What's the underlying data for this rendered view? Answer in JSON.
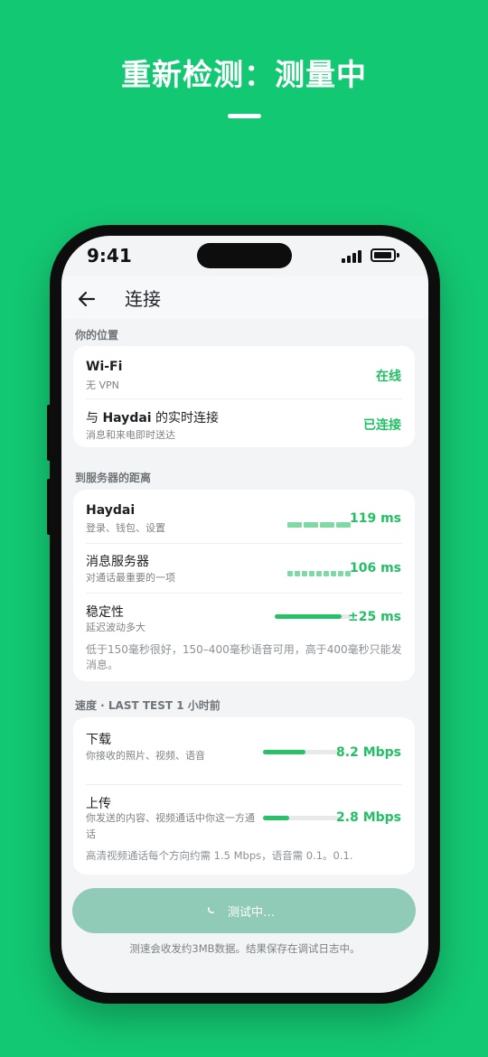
{
  "headline": "重新检测：测量中",
  "status": {
    "time": "9:41"
  },
  "appbar": {
    "title": "连接"
  },
  "location": {
    "section_label": "你的位置",
    "rows": [
      {
        "title": "Wi-Fi",
        "subtitle": "无 VPN",
        "value": "在线"
      },
      {
        "title_prefix": "与 ",
        "title_bold": "Haydai",
        "title_suffix": " 的实时连接",
        "subtitle": "消息和来电即时送达",
        "value": "已连接"
      }
    ]
  },
  "distance": {
    "section_label": "到服务器的距离",
    "rows": [
      {
        "title": "Haydai",
        "subtitle": "登录、钱包、设置",
        "value": "119 ms",
        "segments": 4
      },
      {
        "title": "消息服务器",
        "subtitle": "对通话最重要的一项",
        "value": "106 ms",
        "segments": 9
      },
      {
        "title": "稳定性",
        "subtitle": "延迟波动多大",
        "value": "±25 ms",
        "level": 0.88
      }
    ],
    "note": "低于150毫秒很好，150–400毫秒语音可用，高于400毫秒只能发消息。"
  },
  "speed": {
    "section_label": "速度 · LAST TEST 1 小时前",
    "rows": [
      {
        "title": "下载",
        "subtitle": "你接收的照片、视频、语音",
        "value": "8.2 Mbps",
        "level": 0.56
      },
      {
        "title": "上传",
        "subtitle": "你发送的内容、视频通话中你这一方通话",
        "value": "2.8 Mbps",
        "level": 0.34
      }
    ],
    "note": "高清视频通话每个方向约需 1.5 Mbps，语音需 0.1。0.1."
  },
  "cta": {
    "label": "测试中…"
  },
  "footer_note": "测速会收发约3MB数据。结果保存在调试日志中。",
  "colors": {
    "brand": "#13c872",
    "accent": "#22c065",
    "button_disabled": "#8fcbb6"
  }
}
